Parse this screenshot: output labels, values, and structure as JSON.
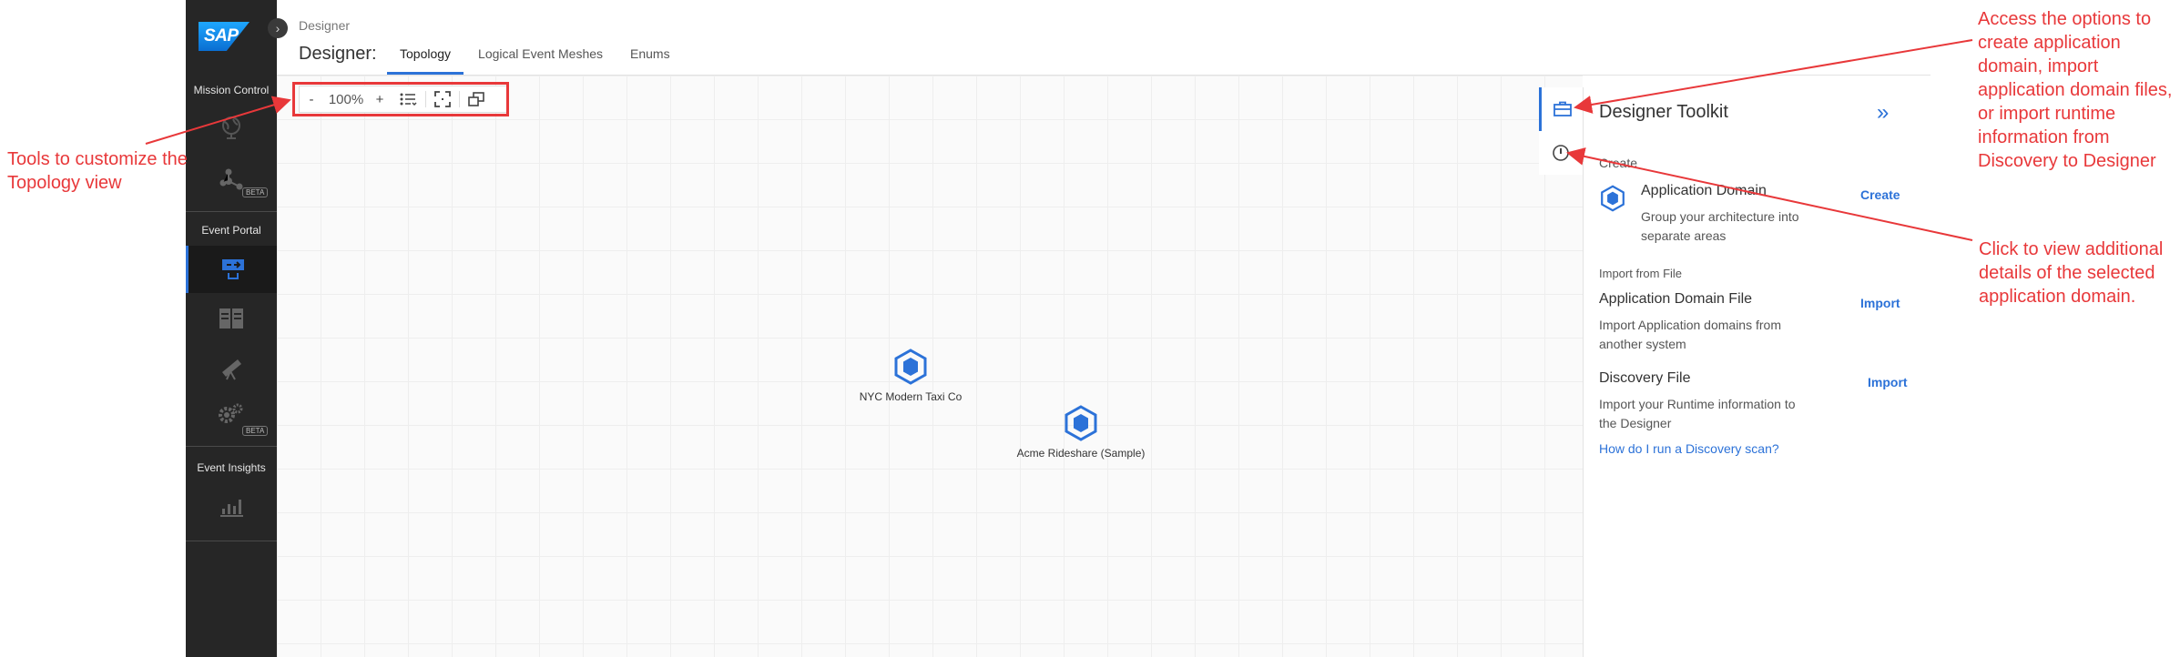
{
  "annotations": {
    "left": "Tools to customize the Topology view",
    "top_right": "Access the options to create application domain, import application domain files, or import runtime information from Discovery to Designer",
    "mid_right": "Click to view additional details of the selected application domain.",
    "color": "#e8383a"
  },
  "sidebar": {
    "logo": "SAP",
    "sections": {
      "mission_control": "Mission Control",
      "event_portal": "Event Portal",
      "event_insights": "Event Insights"
    },
    "items": [
      {
        "icon": "globe-icon"
      },
      {
        "icon": "share-network-icon",
        "badge": "BETA"
      },
      {
        "icon": "designer-icon",
        "active": true
      },
      {
        "icon": "catalog-icon"
      },
      {
        "icon": "telescope-icon"
      },
      {
        "icon": "gears-icon",
        "badge": "BETA"
      },
      {
        "icon": "bar-chart-icon"
      }
    ],
    "accent": "#2c72d8"
  },
  "header": {
    "breadcrumb": "Designer",
    "title": "Designer:",
    "tabs": [
      {
        "label": "Topology",
        "active": true
      },
      {
        "label": "Logical Event Meshes",
        "active": false
      },
      {
        "label": "Enums",
        "active": false
      }
    ]
  },
  "toolbar": {
    "zoom_out": "-",
    "zoom_level": "100%",
    "zoom_in": "+"
  },
  "nodes": [
    {
      "label": "NYC Modern Taxi Co"
    },
    {
      "label": "Acme Rideshare (Sample)"
    }
  ],
  "toolkit": {
    "title": "Designer Toolkit",
    "create_section": "Create",
    "app_domain": {
      "title": "Application Domain",
      "desc": "Group your architecture into separate areas",
      "action": "Create"
    },
    "import_section": "Import from File",
    "app_domain_file": {
      "title": "Application Domain File",
      "desc": "Import Application domains from another system",
      "action": "Import"
    },
    "discovery_file": {
      "title": "Discovery File",
      "desc": "Import your Runtime information to the Designer",
      "action": "Import"
    },
    "help_link": "How do I run a Discovery scan?"
  }
}
